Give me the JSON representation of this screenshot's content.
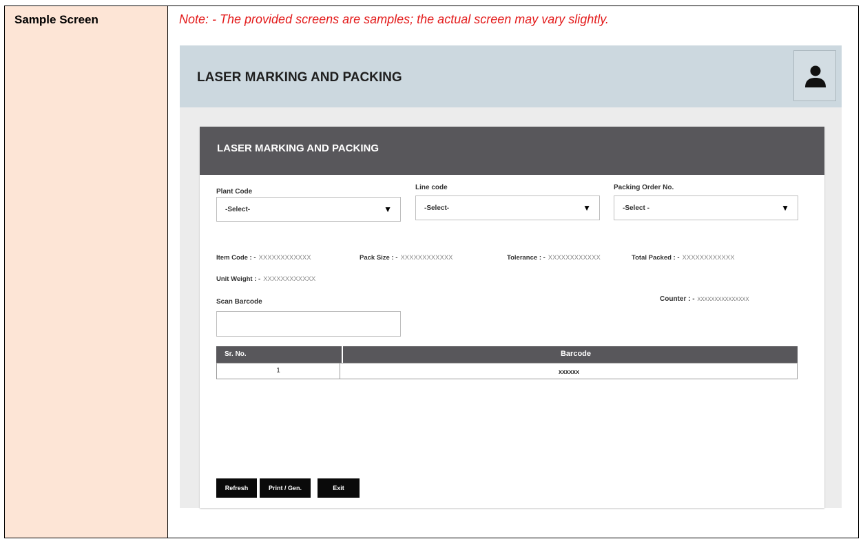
{
  "doc": {
    "row_label": "Sample Screen",
    "note": "Note: - The provided screens are samples; the actual screen may vary slightly."
  },
  "app": {
    "title": "LASER MARKING AND PACKING",
    "user_icon": "user-icon"
  },
  "form": {
    "title": "LASER MARKING AND PACKING",
    "plant_code": {
      "label": "Plant Code",
      "value": "-Select-"
    },
    "line_code": {
      "label": "Line code",
      "value": "-Select-"
    },
    "packing_order": {
      "label": "Packing Order No.",
      "value": "-Select -"
    },
    "dropdown_glyph": "▼",
    "info": {
      "item_code": {
        "label": "Item Code : -",
        "value": "XXXXXXXXXXXX"
      },
      "pack_size": {
        "label": "Pack Size : -",
        "value": "XXXXXXXXXXXX"
      },
      "tolerance": {
        "label": "Tolerance : -",
        "value": "XXXXXXXXXXXX"
      },
      "total_packed": {
        "label": "Total Packed : -",
        "value": "XXXXXXXXXXXX"
      },
      "unit_weight": {
        "label": "Unit Weight : -",
        "value": "XXXXXXXXXXXX"
      },
      "counter": {
        "label": "Counter : -",
        "value": "xxxxxxxxxxxxxxx"
      }
    },
    "scan_barcode": {
      "label": "Scan Barcode",
      "value": ""
    },
    "table": {
      "columns": [
        "Sr. No.",
        "Barcode"
      ],
      "rows": [
        {
          "sr": "1",
          "barcode": "xxxxxx"
        }
      ]
    },
    "buttons": {
      "refresh": "Refresh",
      "print": "Print / Gen.",
      "exit": "Exit"
    }
  }
}
